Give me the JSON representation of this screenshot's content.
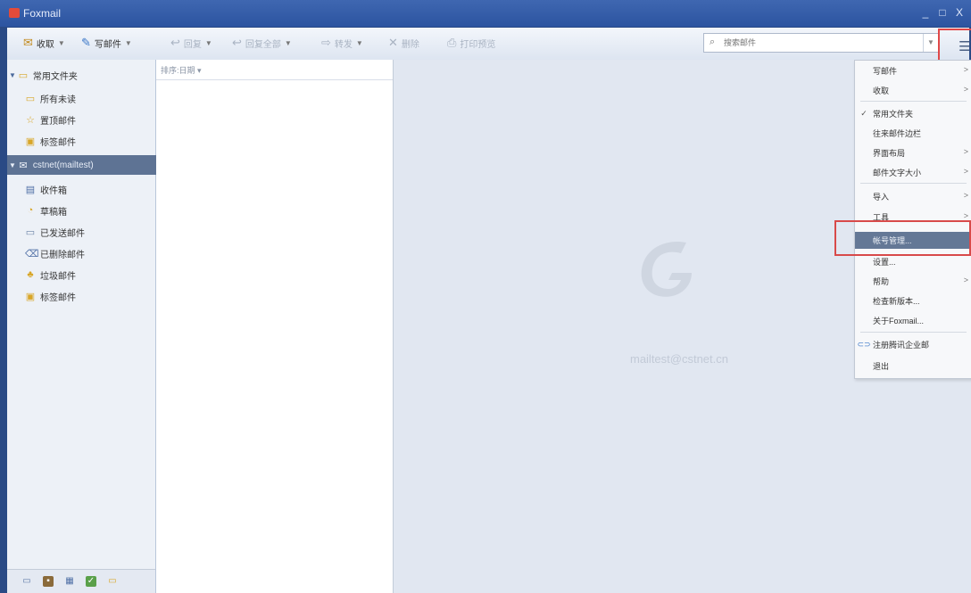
{
  "window": {
    "title": "Foxmail",
    "minimize": "_",
    "maximize": "□",
    "close": "X"
  },
  "toolbar": {
    "receive": "收取",
    "compose": "写邮件",
    "reply": "回复",
    "reply_all": "回复全部",
    "forward": "转发",
    "delete": "删除",
    "print": "打印预览"
  },
  "search": {
    "placeholder": "搜索邮件"
  },
  "sidebar": {
    "common_folder": "常用文件夹",
    "common_items": [
      "所有未读",
      "置顶邮件",
      "标签邮件"
    ],
    "account": "cstnet(mailtest)",
    "account_items": [
      "收件箱",
      "草稿箱",
      "已发送邮件",
      "已删除邮件",
      "垃圾邮件",
      "标签邮件"
    ]
  },
  "message_list": {
    "sort_label": "排序:日期 ▾"
  },
  "reading_pane": {
    "account_email": "mailtest@cstnet.cn"
  },
  "menu": {
    "items": [
      {
        "label": "写邮件",
        "submenu": true,
        "checked": false
      },
      {
        "label": "收取",
        "submenu": true,
        "checked": false
      },
      {
        "label": "常用文件夹",
        "submenu": false,
        "checked": true
      },
      {
        "label": "往来邮件边栏",
        "submenu": false,
        "checked": false
      },
      {
        "label": "界面布局",
        "submenu": true,
        "checked": false
      },
      {
        "label": "邮件文字大小",
        "submenu": true,
        "checked": false
      },
      {
        "label": "导入",
        "submenu": true,
        "checked": false
      },
      {
        "label": "工具",
        "submenu": true,
        "checked": false
      },
      {
        "label": "帐号管理...",
        "submenu": false,
        "checked": false,
        "highlighted": true
      },
      {
        "label": "设置...",
        "submenu": false,
        "checked": false
      },
      {
        "label": "帮助",
        "submenu": true,
        "checked": false
      },
      {
        "label": "检查新版本...",
        "submenu": false,
        "checked": false
      },
      {
        "label": "关于Foxmail...",
        "submenu": false,
        "checked": false
      },
      {
        "label": "注册腾讯企业邮",
        "submenu": false,
        "checked": false
      },
      {
        "label": "退出",
        "submenu": false,
        "checked": false
      }
    ]
  },
  "colors": {
    "accent": "#2c54a0",
    "highlight": "#647896",
    "annotation": "#e04848"
  }
}
